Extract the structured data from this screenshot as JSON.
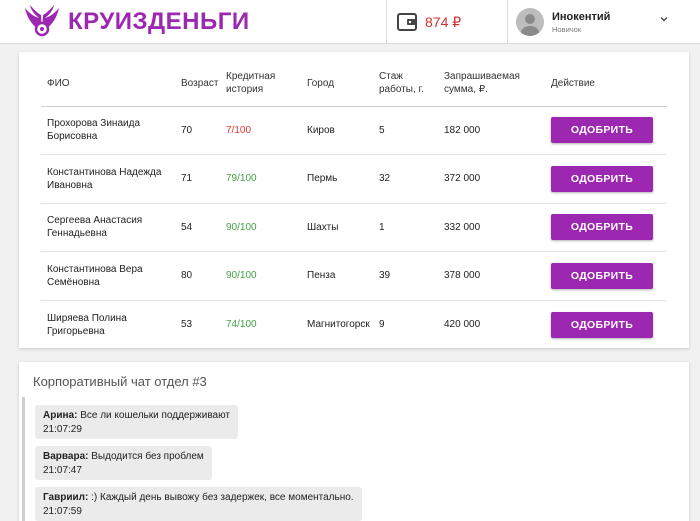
{
  "header": {
    "logo_text": "КРУИЗДЕНЬГИ",
    "brand_color": "#9c27b0",
    "balance": "874 ₽",
    "user": {
      "name": "Инокентий",
      "role": "Новичок"
    }
  },
  "table": {
    "columns": {
      "name": "ФИО",
      "age": "Возраст",
      "credit": "Кредитная история",
      "city": "Город",
      "experience": "Стаж работы, г.",
      "sum": "Запрашиваемая сумма, ₽.",
      "action": "Действие"
    },
    "rows": [
      {
        "name": "Прохорова Зинаида Борисовна",
        "age": "70",
        "credit": "7/100",
        "credit_status": "bad",
        "city": "Киров",
        "experience": "5",
        "sum": "182 000",
        "action": "ОДОБРИТЬ"
      },
      {
        "name": "Константинова Надежда Ивановна",
        "age": "71",
        "credit": "79/100",
        "credit_status": "good",
        "city": "Пермь",
        "experience": "32",
        "sum": "372 000",
        "action": "ОДОБРИТЬ"
      },
      {
        "name": "Сергеева Анастасия Геннадьевна",
        "age": "54",
        "credit": "90/100",
        "credit_status": "good",
        "city": "Шахты",
        "experience": "1",
        "sum": "332 000",
        "action": "ОДОБРИТЬ"
      },
      {
        "name": "Константинова Вера Семёновна",
        "age": "80",
        "credit": "90/100",
        "credit_status": "good",
        "city": "Пенза",
        "experience": "39",
        "sum": "378 000",
        "action": "ОДОБРИТЬ"
      },
      {
        "name": "Ширяева Полина Григорьевна",
        "age": "53",
        "credit": "74/100",
        "credit_status": "good",
        "city": "Магнитогорск",
        "experience": "9",
        "sum": "420 000",
        "action": "ОДОБРИТЬ"
      }
    ]
  },
  "chat": {
    "title": "Корпоративный чат отдел #3",
    "messages": [
      {
        "author": "Арина:",
        "text": " Все ли кошельки поддерживают",
        "time": "21:07:29"
      },
      {
        "author": "Варвара:",
        "text": " Выдодится без проблем",
        "time": "21:07:47"
      },
      {
        "author": "Гавриил:",
        "text": " :) Каждый день вывожу без задержек, все моментально.",
        "time": "21:07:59"
      }
    ]
  },
  "colors": {
    "credit_bad": "#e53935",
    "credit_good": "#43a047",
    "button": "#9c27b0"
  }
}
